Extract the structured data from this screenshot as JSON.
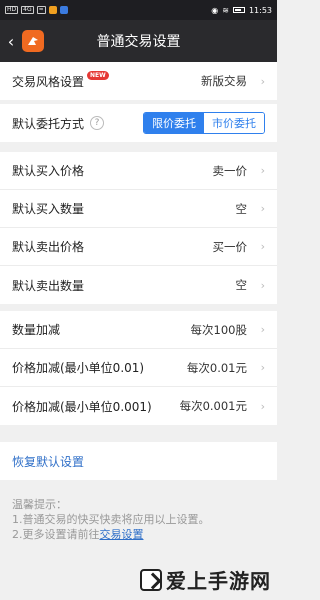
{
  "status_bar": {
    "carrier_chips": [
      "HD",
      "4G",
      "≈"
    ],
    "time": "11:53"
  },
  "header": {
    "title": "普通交易设置",
    "back_glyph": "‹"
  },
  "settings": {
    "style": {
      "label": "交易风格设置",
      "badge": "NEW",
      "value": "新版交易"
    },
    "default_order": {
      "label": "默认委托方式",
      "help": "?",
      "option_limit": "限价委托",
      "option_market": "市价委托",
      "selected": "限价委托"
    },
    "buy_price": {
      "label": "默认买入价格",
      "value": "卖一价"
    },
    "buy_qty": {
      "label": "默认买入数量",
      "value": "空"
    },
    "sell_price": {
      "label": "默认卖出价格",
      "value": "买一价"
    },
    "sell_qty": {
      "label": "默认卖出数量",
      "value": "空"
    },
    "qty_step": {
      "label": "数量加减",
      "value": "每次100股"
    },
    "price_step_2": {
      "label": "价格加减(最小单位0.01)",
      "value": "每次0.01元"
    },
    "price_step_3": {
      "label": "价格加减(最小单位0.001)",
      "value": "每次0.001元"
    }
  },
  "reset": {
    "label": "恢复默认设置"
  },
  "hint": {
    "title": "温馨提示：",
    "line1": "1.普通交易的快买快卖将应用以上设置。",
    "line2_prefix": "2.更多设置请前往",
    "line2_link": "交易设置"
  },
  "watermark": {
    "text": "爱上手游网"
  },
  "colors": {
    "accent": "#2f80ed",
    "header_bg": "#2a2a2d",
    "logo": "#f06a21",
    "badge": "#e53935"
  }
}
